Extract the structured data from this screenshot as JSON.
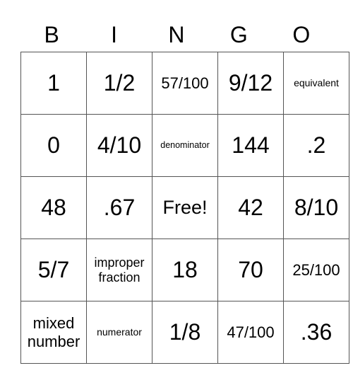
{
  "header": [
    "B",
    "I",
    "N",
    "G",
    "O"
  ],
  "rows": [
    [
      {
        "text": "1",
        "size": "xl"
      },
      {
        "text": "1/2",
        "size": "xl"
      },
      {
        "text": "57/100",
        "size": "m"
      },
      {
        "text": "9/12",
        "size": "xl"
      },
      {
        "text": "equivalent",
        "size": "xs"
      }
    ],
    [
      {
        "text": "0",
        "size": "xl"
      },
      {
        "text": "4/10",
        "size": "xl"
      },
      {
        "text": "denominator",
        "size": "xxs"
      },
      {
        "text": "144",
        "size": "xl"
      },
      {
        "text": ".2",
        "size": "xl"
      }
    ],
    [
      {
        "text": "48",
        "size": "xl"
      },
      {
        "text": ".67",
        "size": "xl"
      },
      {
        "text": "Free!",
        "size": "l"
      },
      {
        "text": "42",
        "size": "xl"
      },
      {
        "text": "8/10",
        "size": "xl"
      }
    ],
    [
      {
        "text": "5/7",
        "size": "xl"
      },
      {
        "text": "improper fraction",
        "size": "s"
      },
      {
        "text": "18",
        "size": "xl"
      },
      {
        "text": "70",
        "size": "xl"
      },
      {
        "text": "25/100",
        "size": "m"
      }
    ],
    [
      {
        "text": "mixed number",
        "size": "m"
      },
      {
        "text": "numerator",
        "size": "xs"
      },
      {
        "text": "1/8",
        "size": "xl"
      },
      {
        "text": "47/100",
        "size": "m"
      },
      {
        "text": ".36",
        "size": "xl"
      }
    ]
  ]
}
